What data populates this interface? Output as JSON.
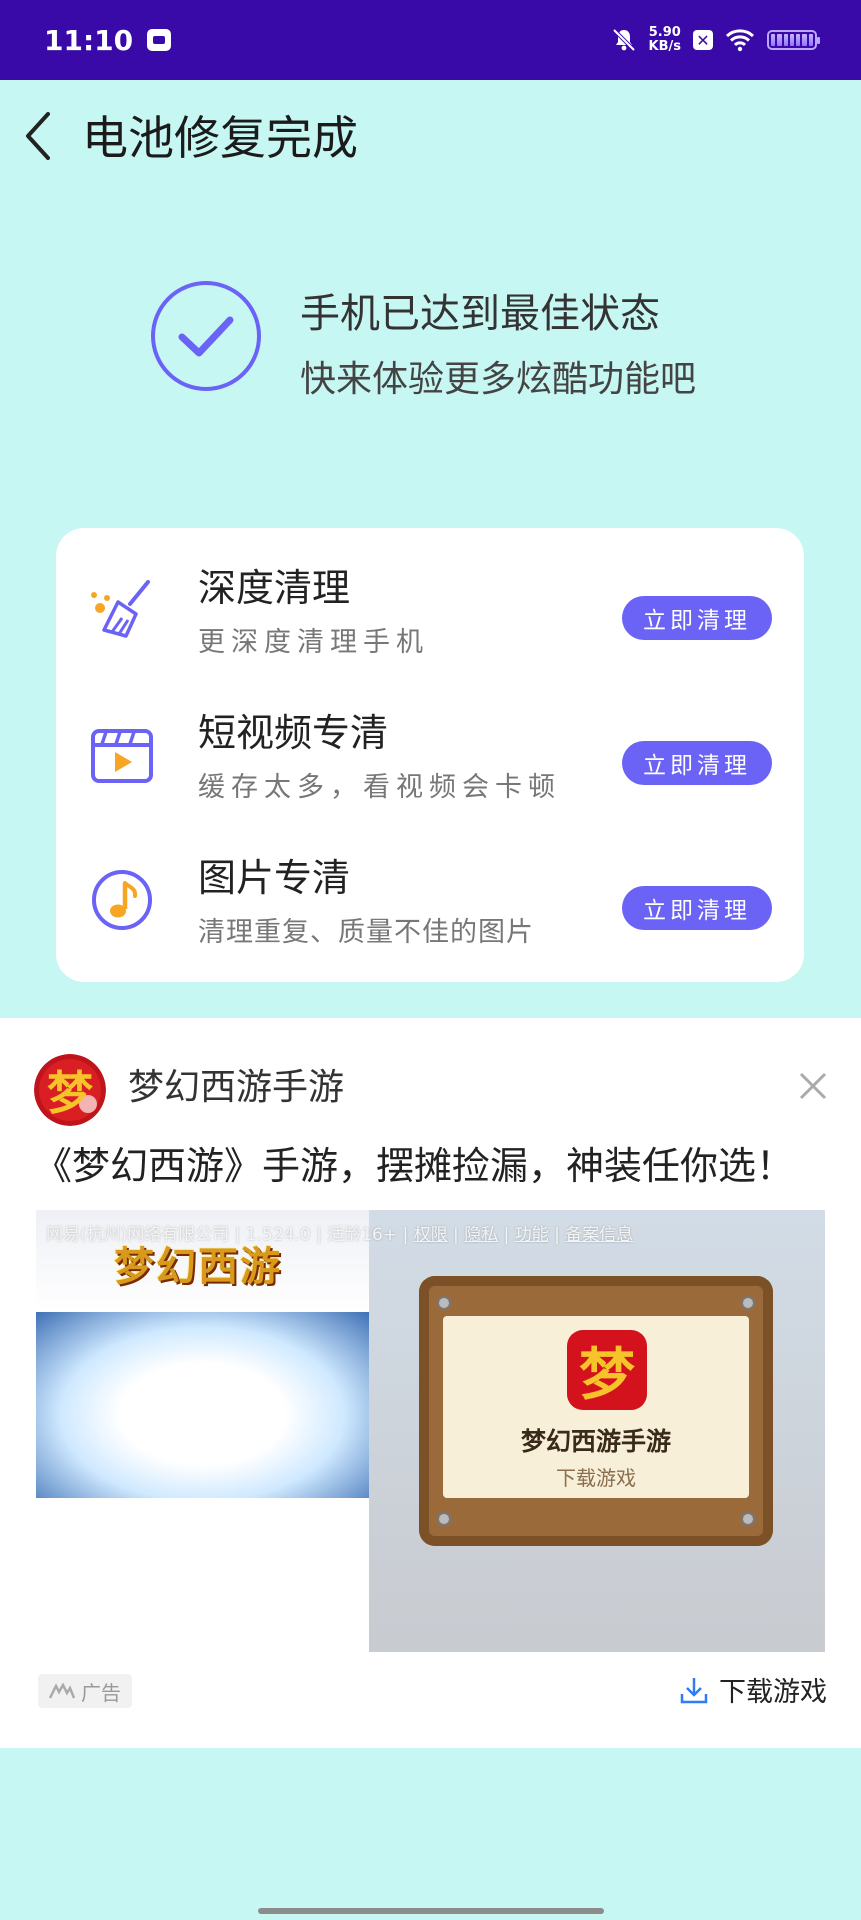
{
  "status_bar": {
    "time": "11:10",
    "net_speed_value": "5.90",
    "net_speed_unit": "KB/s",
    "icons": [
      "app-notification-icon",
      "mute-icon",
      "sim-x-icon",
      "wifi-icon",
      "battery-icon"
    ]
  },
  "header": {
    "title": "电池修复完成"
  },
  "success": {
    "main": "手机已达到最佳状态",
    "sub": "快来体验更多炫酷功能吧"
  },
  "features": [
    {
      "title": "深度清理",
      "desc": "更深度清理手机",
      "button": "立即清理",
      "icon": "broom-icon"
    },
    {
      "title": "短视频专清",
      "desc": "缓存太多，看视频会卡顿",
      "button": "立即清理",
      "icon": "video-icon"
    },
    {
      "title": "图片专清",
      "desc": "清理重复、质量不佳的图片",
      "button": "立即清理",
      "icon": "music-note-icon"
    }
  ],
  "ad": {
    "app_name": "梦幻西游手游",
    "headline": "《梦幻西游》手游，摆摊捡漏，神装任你选！",
    "meta_text": "网易(杭州)网络有限公司 | 1.524.0 | 适龄16+ | ",
    "meta_links": [
      "权限",
      "隐私",
      "功能",
      "备案信息"
    ],
    "left_logo_text": "梦幻西游",
    "board_icon_char": "梦",
    "board_title": "梦幻西游手游",
    "board_sub": "下载游戏",
    "ad_label": "广告",
    "download_label": "下载游戏",
    "logo_char": "梦"
  },
  "colors": {
    "status_bar": "#3a0aa8",
    "background": "#c7f7f3",
    "accent": "#6a63f6",
    "icon_orange": "#f6a623"
  }
}
